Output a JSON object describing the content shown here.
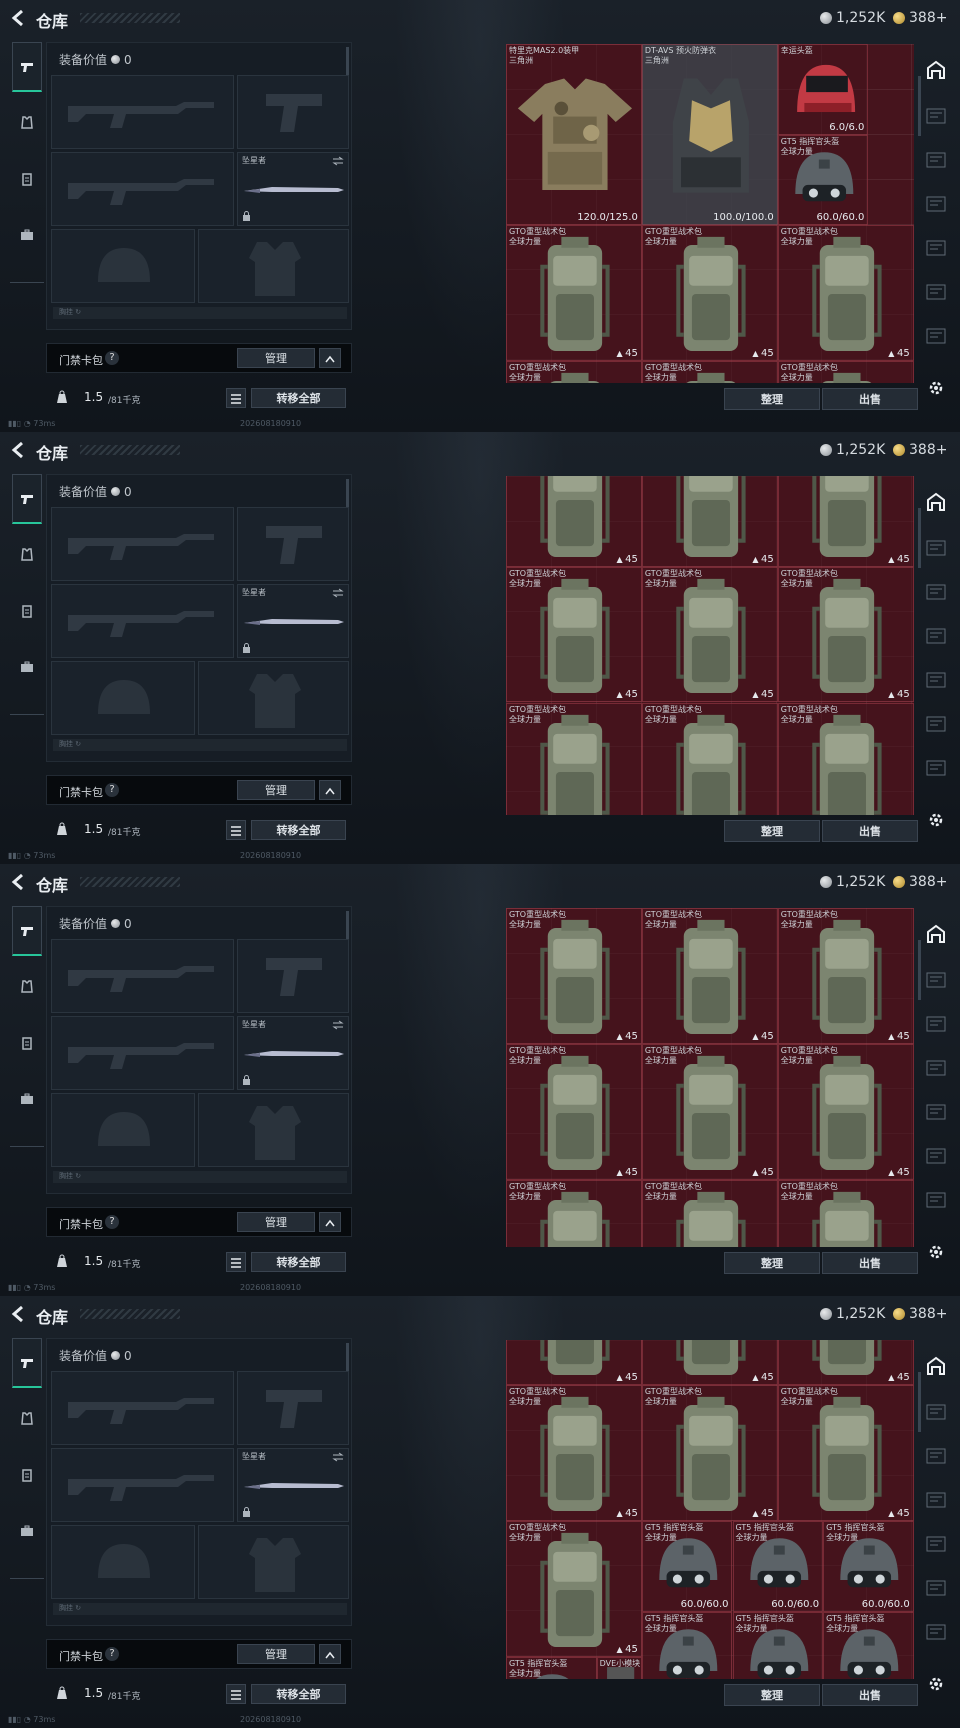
{
  "app": {
    "title": "仓库",
    "silver_amount": "1,252K",
    "gold_amount": "388+"
  },
  "loadout": {
    "value_label": "装备价值",
    "value": "0",
    "melee_name": "坠星者",
    "collapsed_label": "胸挂 ↻"
  },
  "card_pack": {
    "label": "门禁卡包",
    "help": "?",
    "manage_label": "管理"
  },
  "weight": {
    "current": "1.5",
    "max_unit": "/81千克",
    "transfer_all_label": "转移全部"
  },
  "status": {
    "ping": "73ms",
    "build": "202608180910"
  },
  "stash_buttons": {
    "sort_label": "整理",
    "sell_label": "出售"
  },
  "colors": {
    "accent": "#27c59a",
    "stash_bg": "#46141d",
    "button_bg": "#242c35"
  },
  "panels": [
    {
      "items": [
        {
          "kind": "armor1",
          "name": "特里克MAS2.0装甲\n三角洲",
          "durability": "120.0/125.0",
          "col": 0,
          "row": 0,
          "w": 3,
          "h": 4
        },
        {
          "kind": "armor2",
          "name": "DT-AVS 预火防弹衣\n三角洲",
          "durability": "100.0/100.0",
          "col": 3,
          "row": 0,
          "w": 3,
          "h": 4
        },
        {
          "kind": "helmet_red",
          "name": "幸运头盔",
          "durability": "6.0/6.0",
          "col": 6,
          "row": 0,
          "w": 2,
          "h": 2
        },
        {
          "kind": "helmet",
          "name": "GT5 指挥官头盔\n全球力量",
          "durability": "60.0/60.0",
          "col": 6,
          "row": 2,
          "w": 2,
          "h": 2
        },
        {
          "kind": "bag",
          "name": "GTO重型战术包\n全球力量",
          "count": "45",
          "col": 0,
          "row": 4,
          "w": 3,
          "h": 3
        },
        {
          "kind": "bag",
          "name": "GTO重型战术包\n全球力量",
          "count": "45",
          "col": 3,
          "row": 4,
          "w": 3,
          "h": 3
        },
        {
          "kind": "bag",
          "name": "GTO重型战术包\n全球力量",
          "count": "45",
          "col": 6,
          "row": 4,
          "w": 3,
          "h": 3
        },
        {
          "kind": "bag",
          "name": "GTO重型战术包\n全球力量",
          "count": "",
          "col": 0,
          "row": 7,
          "w": 3,
          "h": 3
        },
        {
          "kind": "bag",
          "name": "GTO重型战术包\n全球力量",
          "count": "",
          "col": 3,
          "row": 7,
          "w": 3,
          "h": 3
        },
        {
          "kind": "bag",
          "name": "GTO重型战术包\n全球力量",
          "count": "",
          "col": 6,
          "row": 7,
          "w": 3,
          "h": 3
        }
      ]
    },
    {
      "items": [
        {
          "kind": "bag",
          "name": "",
          "count": "45",
          "col": 0,
          "row": -1,
          "w": 3,
          "h": 3
        },
        {
          "kind": "bag",
          "name": "",
          "count": "45",
          "col": 3,
          "row": -1,
          "w": 3,
          "h": 3
        },
        {
          "kind": "bag",
          "name": "",
          "count": "45",
          "col": 6,
          "row": -1,
          "w": 3,
          "h": 3
        },
        {
          "kind": "bag",
          "name": "GTO重型战术包\n全球力量",
          "count": "45",
          "col": 0,
          "row": 2,
          "w": 3,
          "h": 3
        },
        {
          "kind": "bag",
          "name": "GTO重型战术包\n全球力量",
          "count": "45",
          "col": 3,
          "row": 2,
          "w": 3,
          "h": 3
        },
        {
          "kind": "bag",
          "name": "GTO重型战术包\n全球力量",
          "count": "45",
          "col": 6,
          "row": 2,
          "w": 3,
          "h": 3
        },
        {
          "kind": "bag",
          "name": "GTO重型战术包\n全球力量",
          "count": "",
          "col": 0,
          "row": 5,
          "w": 3,
          "h": 3
        },
        {
          "kind": "bag",
          "name": "GTO重型战术包\n全球力量",
          "count": "",
          "col": 3,
          "row": 5,
          "w": 3,
          "h": 3
        },
        {
          "kind": "bag",
          "name": "GTO重型战术包\n全球力量",
          "count": "",
          "col": 6,
          "row": 5,
          "w": 3,
          "h": 3
        }
      ]
    },
    {
      "items": [
        {
          "kind": "bag",
          "name": "GTO重型战术包\n全球力量",
          "count": "45",
          "col": 0,
          "row": 0,
          "w": 3,
          "h": 3
        },
        {
          "kind": "bag",
          "name": "GTO重型战术包\n全球力量",
          "count": "45",
          "col": 3,
          "row": 0,
          "w": 3,
          "h": 3
        },
        {
          "kind": "bag",
          "name": "GTO重型战术包\n全球力量",
          "count": "45",
          "col": 6,
          "row": 0,
          "w": 3,
          "h": 3
        },
        {
          "kind": "bag",
          "name": "GTO重型战术包\n全球力量",
          "count": "45",
          "col": 0,
          "row": 3,
          "w": 3,
          "h": 3
        },
        {
          "kind": "bag",
          "name": "GTO重型战术包\n全球力量",
          "count": "45",
          "col": 3,
          "row": 3,
          "w": 3,
          "h": 3
        },
        {
          "kind": "bag",
          "name": "GTO重型战术包\n全球力量",
          "count": "45",
          "col": 6,
          "row": 3,
          "w": 3,
          "h": 3
        },
        {
          "kind": "bag",
          "name": "GTO重型战术包\n全球力量",
          "count": "",
          "col": 0,
          "row": 6,
          "w": 3,
          "h": 3
        },
        {
          "kind": "bag",
          "name": "GTO重型战术包\n全球力量",
          "count": "",
          "col": 3,
          "row": 6,
          "w": 3,
          "h": 3
        },
        {
          "kind": "bag",
          "name": "GTO重型战术包\n全球力量",
          "count": "",
          "col": 6,
          "row": 6,
          "w": 3,
          "h": 3
        }
      ]
    },
    {
      "items": [
        {
          "kind": "bag",
          "name": "",
          "count": "45",
          "col": 0,
          "row": -2,
          "w": 3,
          "h": 3
        },
        {
          "kind": "bag",
          "name": "",
          "count": "45",
          "col": 3,
          "row": -2,
          "w": 3,
          "h": 3
        },
        {
          "kind": "bag",
          "name": "",
          "count": "45",
          "col": 6,
          "row": -2,
          "w": 3,
          "h": 3
        },
        {
          "kind": "bag",
          "name": "GTO重型战术包\n全球力量",
          "count": "45",
          "col": 0,
          "row": 1,
          "w": 3,
          "h": 3
        },
        {
          "kind": "bag",
          "name": "GTO重型战术包\n全球力量",
          "count": "45",
          "col": 3,
          "row": 1,
          "w": 3,
          "h": 3
        },
        {
          "kind": "bag",
          "name": "GTO重型战术包\n全球力量",
          "count": "45",
          "col": 6,
          "row": 1,
          "w": 3,
          "h": 3
        },
        {
          "kind": "bag",
          "name": "GTO重型战术包\n全球力量",
          "count": "45",
          "col": 0,
          "row": 4,
          "w": 3,
          "h": 3
        },
        {
          "kind": "helmet",
          "name": "GT5 指挥官头盔\n全球力量",
          "durability": "60.0/60.0",
          "col": 3,
          "row": 4,
          "w": 2,
          "h": 2
        },
        {
          "kind": "helmet",
          "name": "GT5 指挥官头盔\n全球力量",
          "durability": "60.0/60.0",
          "col": 5,
          "row": 4,
          "w": 2,
          "h": 2
        },
        {
          "kind": "helmet",
          "name": "GT5 指挥官头盔\n全球力量",
          "durability": "60.0/60.0",
          "col": 7,
          "row": 4,
          "w": 2,
          "h": 2
        },
        {
          "kind": "helmet",
          "name": "GT5 指挥官头盔\n全球力量",
          "durability": "",
          "col": 3,
          "row": 6,
          "w": 2,
          "h": 2
        },
        {
          "kind": "helmet",
          "name": "GT5 指挥官头盔\n全球力量",
          "durability": "",
          "col": 5,
          "row": 6,
          "w": 2,
          "h": 2
        },
        {
          "kind": "helmet",
          "name": "GT5 指挥官头盔\n全球力量",
          "durability": "",
          "col": 7,
          "row": 6,
          "w": 2,
          "h": 2
        },
        {
          "kind": "helmet",
          "name": "GT5 指挥官头盔\n全球力量",
          "durability": "",
          "col": 0,
          "row": 7,
          "w": 2,
          "h": 2
        },
        {
          "kind": "plate",
          "name": "DVE小模块",
          "durability": "",
          "col": 2,
          "row": 7,
          "w": 1,
          "h": 1
        }
      ]
    }
  ]
}
